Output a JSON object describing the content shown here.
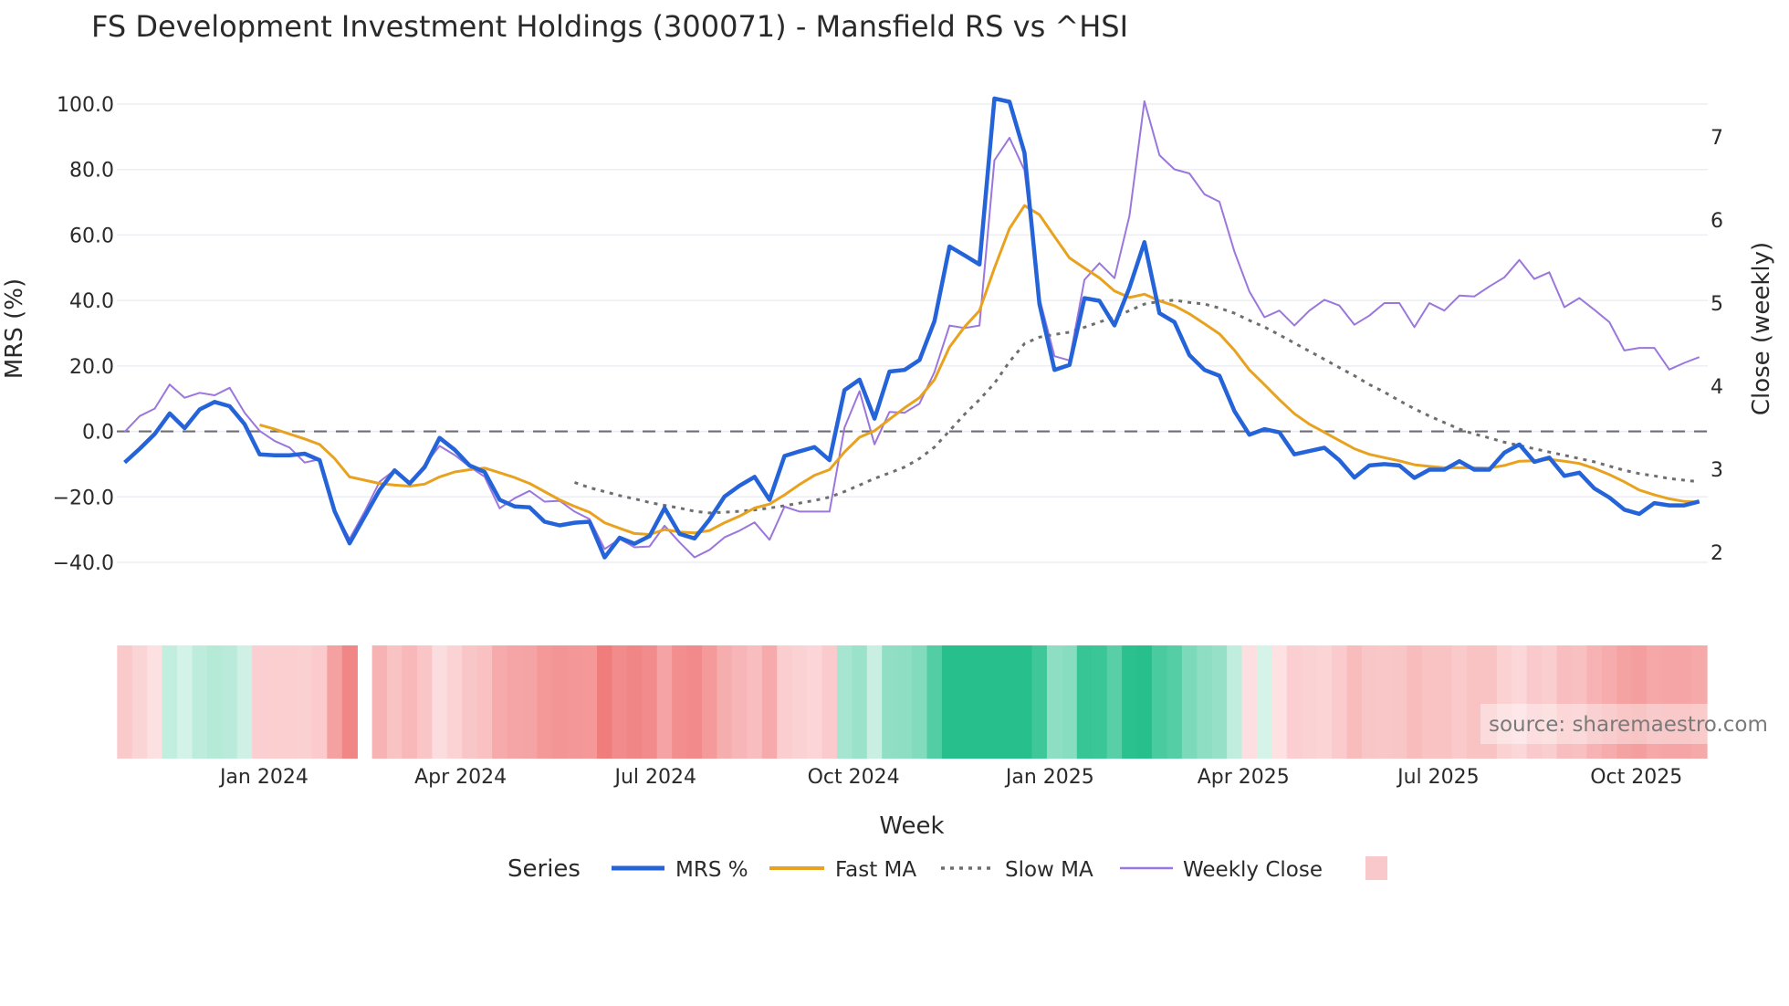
{
  "chart_data": {
    "type": "line",
    "title": "FS Development Investment Holdings (300071) - Mansfield RS vs ^HSI",
    "xlabel": "Week",
    "ylabel": "MRS (%)",
    "y2label": "Close (weekly)",
    "ylim": [
      -40,
      100
    ],
    "y2lim": [
      2,
      7
    ],
    "yticks": [
      "100.0",
      "80.0",
      "60.0",
      "40.0",
      "20.0",
      "0.0",
      "−20.0",
      "−40.0"
    ],
    "ytick_values": [
      100,
      80,
      60,
      40,
      20,
      0,
      -20,
      -40
    ],
    "y2ticks": [
      "7",
      "6",
      "5",
      "4",
      "3",
      "2"
    ],
    "y2tick_values": [
      7,
      6,
      5,
      4,
      3,
      2
    ],
    "xticks": [
      "Jan 2024",
      "Apr 2024",
      "Jul 2024",
      "Oct 2024",
      "Jan 2025",
      "Apr 2025",
      "Jul 2025",
      "Oct 2025"
    ],
    "xtick_week_index": [
      9.3,
      22.4,
      35.4,
      48.6,
      61.7,
      74.6,
      87.6,
      100.8
    ],
    "zero_line": 0,
    "grid": true,
    "legend": {
      "title": "Series",
      "placement": "bottom-center"
    },
    "series": [
      {
        "name": "MRS %",
        "axis": "left",
        "color": "#2563d9",
        "style": "solid-thick",
        "start_index": 0,
        "values": [
          -9.5,
          -5.3,
          -0.8,
          5.5,
          1.0,
          6.7,
          9.0,
          7.7,
          2.2,
          -7.0,
          -7.3,
          -7.3,
          -6.8,
          -8.8,
          -24.4,
          -34.2,
          -26.0,
          -17.9,
          -11.9,
          -15.9,
          -10.9,
          -2.0,
          -5.6,
          -10.4,
          -12.4,
          -20.9,
          -22.9,
          -23.2,
          -27.6,
          -28.7,
          -27.9,
          -27.6,
          -38.5,
          -32.5,
          -34.3,
          -32.0,
          -23.4,
          -31.3,
          -32.7,
          -26.9,
          -19.9,
          -16.6,
          -13.9,
          -20.9,
          -7.5,
          -6.1,
          -4.8,
          -8.8,
          12.6,
          15.8,
          3.9,
          18.3,
          18.8,
          21.8,
          33.7,
          56.5,
          53.8,
          51.0,
          101.7,
          100.7,
          85.1,
          38.9,
          18.8,
          20.3,
          40.7,
          39.9,
          32.4,
          43.9,
          57.8,
          36.1,
          33.4,
          23.3,
          18.8,
          17.0,
          6.2,
          -1.0,
          0.7,
          -0.3,
          -7.0,
          -6.0,
          -5.0,
          -8.8,
          -14.1,
          -10.4,
          -10.0,
          -10.4,
          -14.2,
          -11.7,
          -11.7,
          -9.1,
          -11.7,
          -11.7,
          -6.5,
          -4.0,
          -9.3,
          -8.0,
          -13.6,
          -12.6,
          -17.4,
          -20.2,
          -23.9,
          -25.2,
          -21.9,
          -22.6,
          -22.6,
          -21.4
        ]
      },
      {
        "name": "Fast MA",
        "axis": "left",
        "color": "#e8a21f",
        "style": "solid",
        "start_index": 9,
        "values": [
          2.0,
          0.7,
          -0.8,
          -2.3,
          -4.0,
          -8.3,
          -13.9,
          -14.9,
          -15.9,
          -16.4,
          -16.7,
          -16.1,
          -13.9,
          -12.4,
          -11.7,
          -11.2,
          -12.6,
          -14.1,
          -15.9,
          -18.4,
          -20.9,
          -22.9,
          -24.7,
          -27.9,
          -29.6,
          -31.2,
          -31.5,
          -30.0,
          -30.7,
          -31.0,
          -30.3,
          -27.9,
          -25.9,
          -23.4,
          -22.2,
          -19.4,
          -16.2,
          -13.4,
          -11.7,
          -6.3,
          -1.8,
          0.2,
          3.7,
          7.2,
          10.3,
          15.8,
          25.8,
          31.9,
          36.9,
          49.9,
          62.0,
          69.0,
          66.2,
          59.5,
          53.0,
          49.9,
          46.9,
          42.9,
          40.9,
          41.9,
          39.9,
          38.4,
          35.9,
          32.9,
          29.8,
          24.8,
          18.8,
          14.3,
          9.7,
          5.4,
          2.2,
          -0.3,
          -2.8,
          -5.3,
          -7.0,
          -8.0,
          -9.0,
          -10.2,
          -10.7,
          -11.1,
          -11.1,
          -11.1,
          -11.2,
          -10.4,
          -9.1,
          -9.0,
          -8.5,
          -9.1,
          -9.8,
          -11.3,
          -13.2,
          -15.4,
          -17.9,
          -19.4,
          -20.6,
          -21.4,
          -21.6
        ]
      },
      {
        "name": "Slow MA",
        "axis": "left",
        "color": "#6e6e6e",
        "style": "dotted",
        "start_index": 30,
        "values": [
          -15.6,
          -17.2,
          -18.4,
          -19.6,
          -20.6,
          -21.7,
          -22.6,
          -23.4,
          -24.4,
          -24.9,
          -24.7,
          -24.4,
          -24.0,
          -23.4,
          -22.7,
          -21.9,
          -21.1,
          -20.1,
          -18.4,
          -16.4,
          -14.4,
          -12.7,
          -10.9,
          -8.3,
          -4.8,
          0.2,
          5.2,
          9.7,
          14.7,
          21.3,
          26.8,
          28.8,
          29.6,
          30.3,
          31.8,
          33.4,
          34.9,
          36.9,
          38.9,
          39.7,
          40.1,
          39.4,
          38.9,
          37.7,
          36.1,
          33.9,
          31.9,
          29.5,
          27.0,
          24.5,
          22.0,
          19.5,
          17.0,
          14.3,
          12.0,
          9.4,
          6.9,
          4.7,
          2.7,
          0.7,
          -0.8,
          -2.0,
          -3.3,
          -4.3,
          -5.3,
          -6.3,
          -7.3,
          -8.3,
          -9.3,
          -10.6,
          -11.9,
          -12.9,
          -13.6,
          -14.4,
          -14.9,
          -15.4
        ]
      },
      {
        "name": "Weekly Close",
        "axis": "right",
        "color": "#9b76dd",
        "style": "solid-thin",
        "start_index": 0,
        "values": [
          3.45,
          3.64,
          3.73,
          4.02,
          3.86,
          3.92,
          3.89,
          3.98,
          3.68,
          3.46,
          3.34,
          3.26,
          3.08,
          3.12,
          2.49,
          2.16,
          2.49,
          2.85,
          2.99,
          2.83,
          3.05,
          3.28,
          3.17,
          3.03,
          2.91,
          2.53,
          2.65,
          2.74,
          2.61,
          2.62,
          2.49,
          2.4,
          2.04,
          2.16,
          2.06,
          2.07,
          2.32,
          2.12,
          1.94,
          2.03,
          2.18,
          2.26,
          2.36,
          2.15,
          2.55,
          2.49,
          2.49,
          2.49,
          3.5,
          3.94,
          3.3,
          3.69,
          3.68,
          3.79,
          4.17,
          4.73,
          4.7,
          4.73,
          6.72,
          6.99,
          6.6,
          5.06,
          4.36,
          4.31,
          5.28,
          5.48,
          5.3,
          6.05,
          7.43,
          6.78,
          6.61,
          6.56,
          6.31,
          6.22,
          5.62,
          5.14,
          4.83,
          4.91,
          4.73,
          4.91,
          5.04,
          4.97,
          4.74,
          4.85,
          5.0,
          5.0,
          4.71,
          5.0,
          4.91,
          5.09,
          5.08,
          5.2,
          5.31,
          5.52,
          5.29,
          5.37,
          4.95,
          5.06,
          4.92,
          4.77,
          4.43,
          4.46,
          4.46,
          4.2,
          4.28,
          4.35
        ]
      }
    ],
    "heatmap": {
      "source_series": "MRS %",
      "missing_week_index": [
        16
      ],
      "negative_color": "#f07c7c",
      "positive_color": "#27c08d"
    },
    "source_note": "source: sharemaestro.com"
  }
}
